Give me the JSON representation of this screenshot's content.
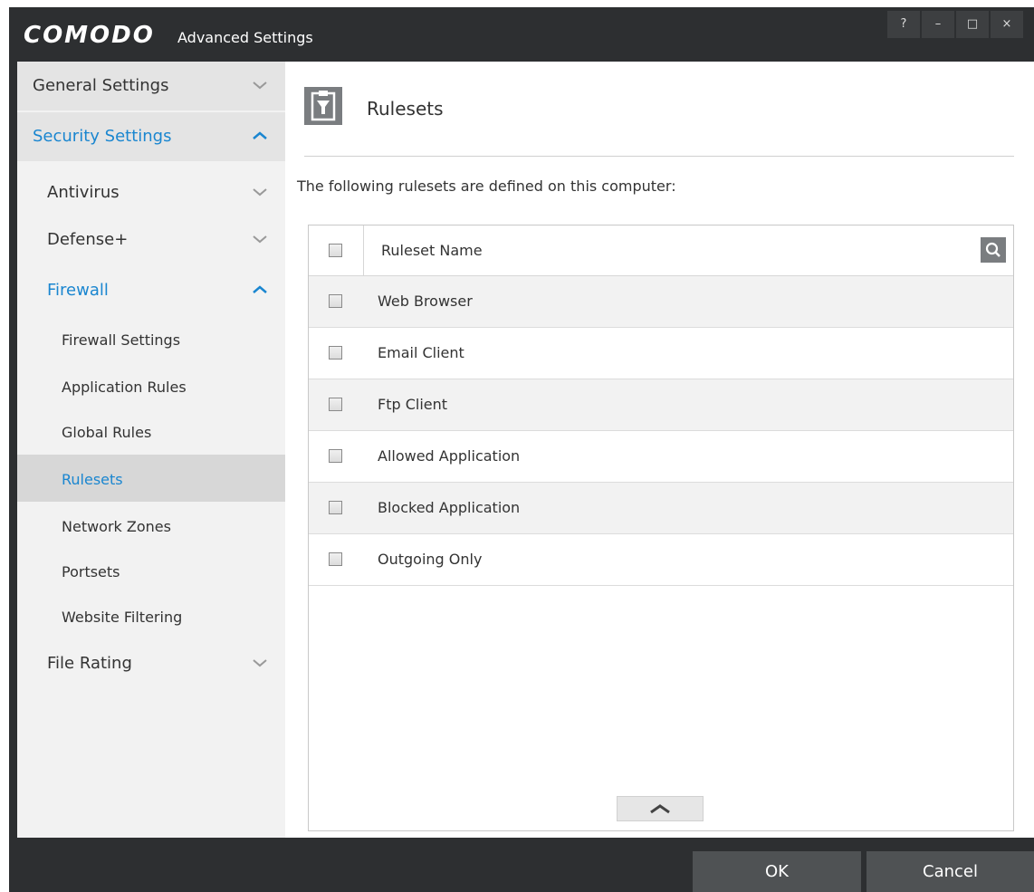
{
  "window": {
    "brand": "COMODO",
    "title": "Advanced Settings",
    "controls": {
      "help": "?",
      "minimize": "–",
      "maximize": "□",
      "close": "×"
    }
  },
  "sidebar": {
    "general": "General Settings",
    "security": "Security Settings",
    "antivirus": "Antivirus",
    "defense": "Defense+",
    "firewall": "Firewall",
    "firewall_items": [
      "Firewall Settings",
      "Application Rules",
      "Global Rules",
      "Rulesets",
      "Network Zones",
      "Portsets",
      "Website Filtering"
    ],
    "file_rating": "File Rating"
  },
  "main": {
    "title": "Rulesets",
    "description": "The following rulesets are defined on this computer:",
    "column_header": "Ruleset Name",
    "rows": [
      "Web Browser",
      "Email Client",
      "Ftp Client",
      "Allowed Application",
      "Blocked Application",
      "Outgoing Only"
    ]
  },
  "footer": {
    "ok": "OK",
    "cancel": "Cancel"
  },
  "colors": {
    "accent": "#1a86d0",
    "dark": "#2d2f31",
    "button": "#4f5254",
    "icon_gray": "#7a7d80"
  }
}
